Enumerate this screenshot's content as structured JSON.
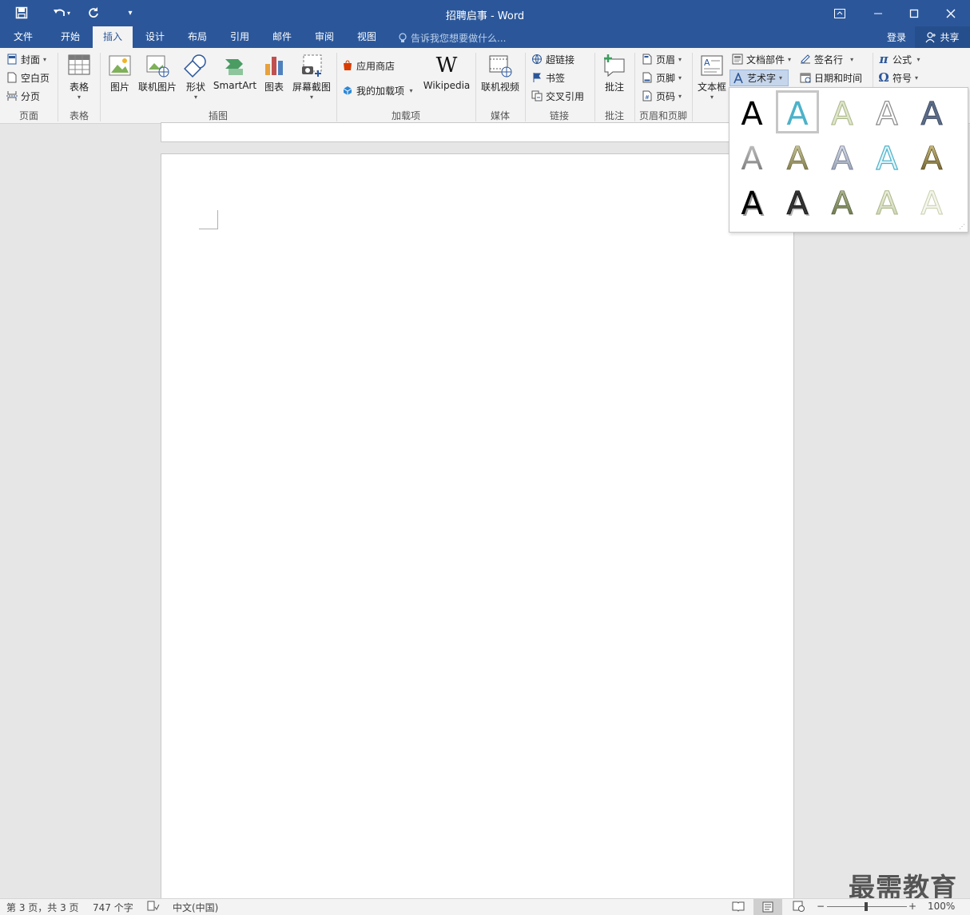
{
  "window": {
    "title": "招聘启事 - Word"
  },
  "tabs": [
    {
      "label": "文件",
      "active": false
    },
    {
      "label": "开始",
      "active": false
    },
    {
      "label": "插入",
      "active": true
    },
    {
      "label": "设计",
      "active": false
    },
    {
      "label": "布局",
      "active": false
    },
    {
      "label": "引用",
      "active": false
    },
    {
      "label": "邮件",
      "active": false
    },
    {
      "label": "审阅",
      "active": false
    },
    {
      "label": "视图",
      "active": false
    }
  ],
  "tellme": {
    "placeholder": "告诉我您想要做什么..."
  },
  "account": {
    "login": "登录",
    "share": "共享"
  },
  "ribbon": {
    "pages": {
      "cover": "封面",
      "blank": "空白页",
      "break": "分页",
      "group": "页面"
    },
    "tables": {
      "table": "表格",
      "group": "表格"
    },
    "illustrations": {
      "picture": "图片",
      "online_picture": "联机图片",
      "shapes": "形状",
      "smartart": "SmartArt",
      "chart": "图表",
      "screenshot": "屏幕截图",
      "group": "插图"
    },
    "addins": {
      "store": "应用商店",
      "my_addins": "我的加载项",
      "wikipedia": "Wikipedia",
      "group": "加载项"
    },
    "media": {
      "online_video": "联机视频",
      "group": "媒体"
    },
    "links": {
      "hyperlink": "超链接",
      "bookmark": "书签",
      "crossref": "交叉引用",
      "group": "链接"
    },
    "comments": {
      "comment": "批注",
      "group": "批注"
    },
    "header_footer": {
      "header": "页眉",
      "footer": "页脚",
      "page_number": "页码",
      "group": "页眉和页脚"
    },
    "text": {
      "textbox": "文本框",
      "quick_parts": "文档部件",
      "wordart": "艺术字",
      "signature": "签名行",
      "datetime": "日期和时间"
    },
    "symbols": {
      "equation": "公式",
      "symbol": "符号"
    }
  },
  "watermark": "最需教育",
  "status": {
    "page": "第 3 页，共 3 页",
    "words": "747 个字",
    "language": "中文(中国)",
    "zoom": "100%"
  },
  "colors": {
    "accent": "#2b579a"
  }
}
